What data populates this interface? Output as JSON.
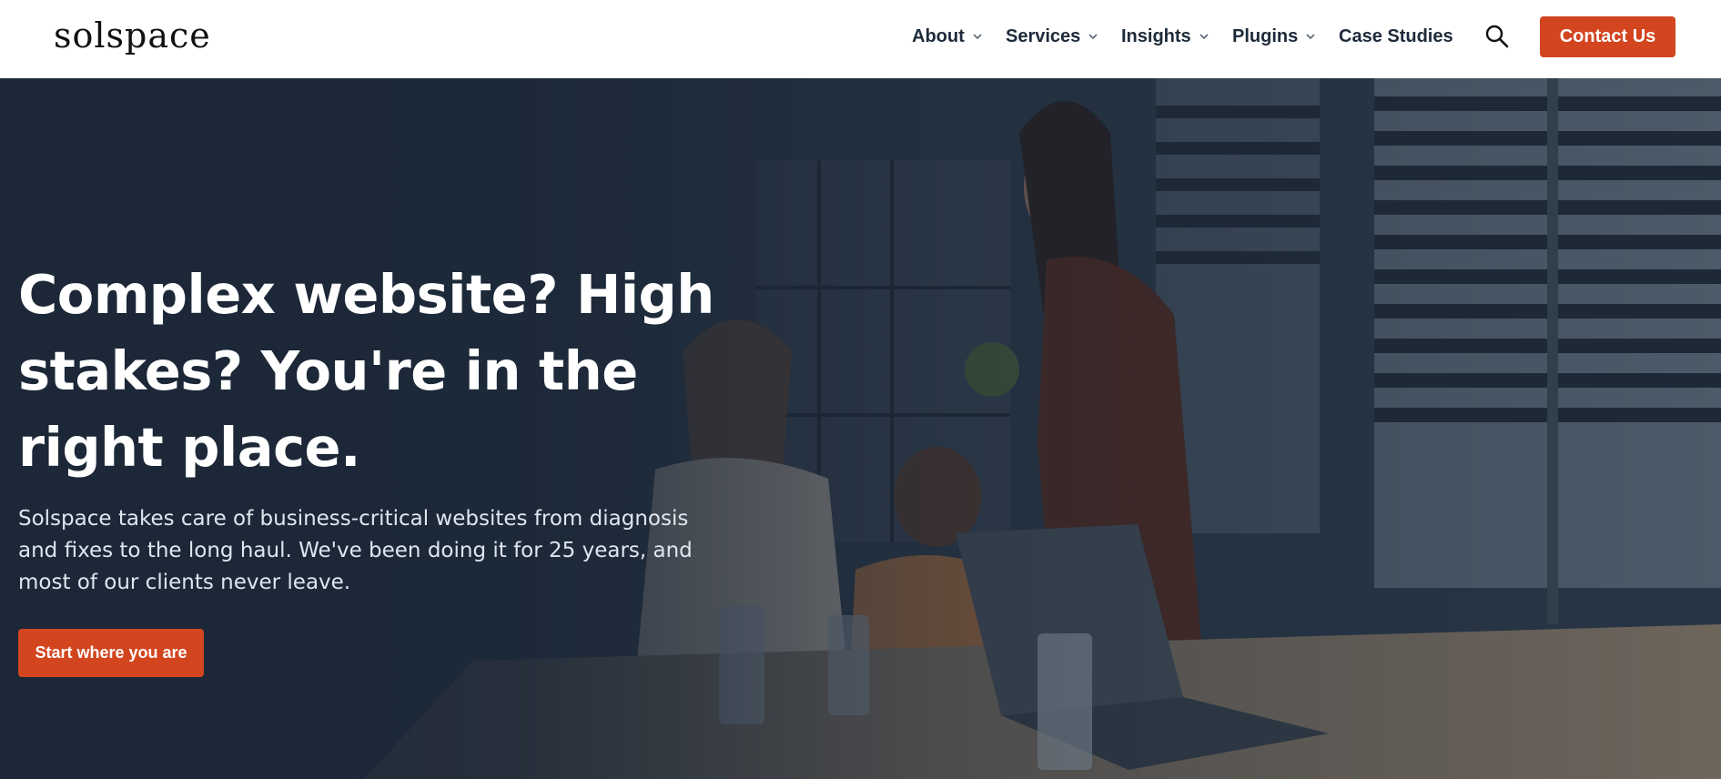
{
  "brand": {
    "logo_text": "solspace"
  },
  "nav": {
    "items": [
      {
        "label": "About",
        "has_dropdown": true
      },
      {
        "label": "Services",
        "has_dropdown": true
      },
      {
        "label": "Insights",
        "has_dropdown": true
      },
      {
        "label": "Plugins",
        "has_dropdown": true
      },
      {
        "label": "Case Studies",
        "has_dropdown": false
      }
    ],
    "search_icon": "search-icon",
    "contact_label": "Contact Us"
  },
  "hero": {
    "title": "Complex website? High stakes? You're in the right place.",
    "description": "Solspace takes care of business-critical websites from diagnosis and fixes to the long haul. We've been doing it for 25 years, and most of our clients never leave.",
    "cta_label": "Start where you are"
  },
  "colors": {
    "accent": "#d2451e",
    "hero_overlay": "#1b2736",
    "nav_text": "#1d2a3a"
  }
}
